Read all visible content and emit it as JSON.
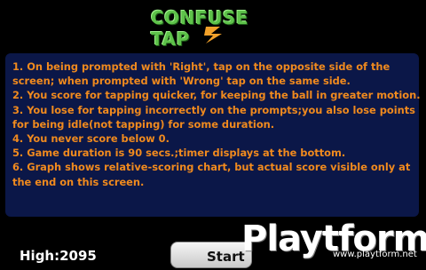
{
  "logo": {
    "text": "CONFUSE TAP"
  },
  "rules": [
    {
      "line1": "1. On being prompted with 'Right', tap on the opposite side of the",
      "line2": "screen; when prompted with 'Wrong' tap on the same side."
    },
    {
      "line1": "2. You score for tapping quicker, for keeping the ball in greater motion.",
      "line2": ""
    },
    {
      "line1": "3. You lose for tapping incorrectly on the prompts;you also lose points",
      "line2": "for being idle(not tapping) for some duration."
    },
    {
      "line1": "4. You never score below 0.",
      "line2": ""
    },
    {
      "line1": "5. Game duration is 90 secs.;timer displays at the bottom.",
      "line2": ""
    },
    {
      "line1": "6. Graph shows relative-scoring chart, but actual score visible only at",
      "line2": "the end on this screen."
    }
  ],
  "high_score": "High:2095",
  "start_label": "Start",
  "watermark": {
    "text": "Playtform",
    "url": "www.playtform.net"
  },
  "colors": {
    "rule_text": "#f08a1e",
    "panel": "#0b1748",
    "logo_green": "#5ec24a",
    "bolt": "#f2a12a"
  }
}
